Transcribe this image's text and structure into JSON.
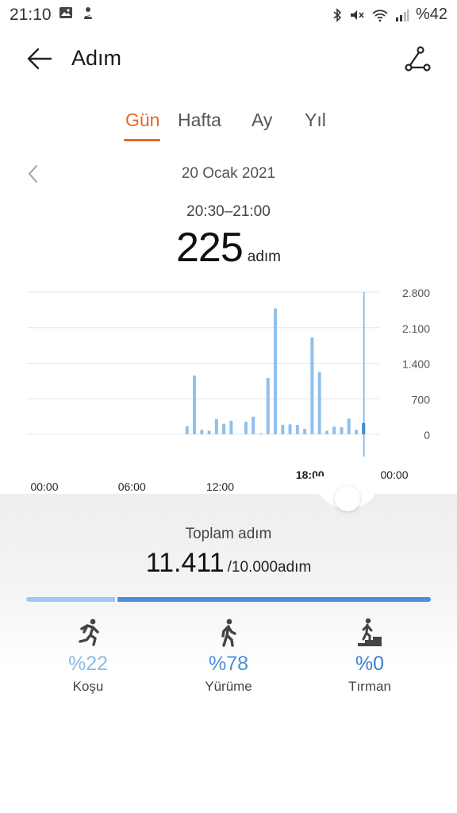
{
  "status_bar": {
    "time": "21:10",
    "battery": "%42",
    "left_icons": [
      "image-icon",
      "app-notification-icon"
    ],
    "right_icons": [
      "bluetooth-icon",
      "mute-icon",
      "wifi-icon",
      "signal-icon"
    ]
  },
  "header": {
    "title": "Adım",
    "back_icon": "arrow-left-icon",
    "share_icon": "route-icon"
  },
  "tabs": [
    {
      "label": "Gün",
      "active": true
    },
    {
      "label": "Hafta",
      "active": false
    },
    {
      "label": "Ay",
      "active": false
    },
    {
      "label": "Yıl",
      "active": false
    }
  ],
  "date": {
    "label": "20 Ocak 2021",
    "prev_icon": "chevron-left-icon"
  },
  "selection": {
    "range": "20:30–21:00",
    "value": "225",
    "unit": "adım"
  },
  "chart_data": {
    "type": "bar",
    "title": "",
    "xlabel": "",
    "ylabel": "",
    "x_unit": "hour of day",
    "ylim": [
      0,
      2800
    ],
    "y_ticks": [
      "2.800",
      "2.100",
      "1.400",
      "700",
      "0"
    ],
    "y_tick_values": [
      2800,
      2100,
      1400,
      700,
      0
    ],
    "x_tick_labels": [
      "00:00",
      "06:00",
      "12:00",
      "18:00",
      "00:00"
    ],
    "x_tick_hours": [
      0,
      6,
      12,
      18,
      24
    ],
    "highlighted_tick": "18:00",
    "grid": true,
    "bars": [
      {
        "x": 9.75,
        "value": 160
      },
      {
        "x": 10.25,
        "value": 1160
      },
      {
        "x": 10.75,
        "value": 90
      },
      {
        "x": 11.25,
        "value": 70
      },
      {
        "x": 11.75,
        "value": 300
      },
      {
        "x": 12.25,
        "value": 210
      },
      {
        "x": 12.75,
        "value": 270
      },
      {
        "x": 13.75,
        "value": 250
      },
      {
        "x": 14.25,
        "value": 350
      },
      {
        "x": 14.75,
        "value": 20
      },
      {
        "x": 15.25,
        "value": 1110
      },
      {
        "x": 15.75,
        "value": 2480
      },
      {
        "x": 16.25,
        "value": 190
      },
      {
        "x": 16.75,
        "value": 200
      },
      {
        "x": 17.25,
        "value": 185
      },
      {
        "x": 17.75,
        "value": 110
      },
      {
        "x": 18.25,
        "value": 1910
      },
      {
        "x": 18.75,
        "value": 1230
      },
      {
        "x": 19.25,
        "value": 70
      },
      {
        "x": 19.75,
        "value": 150
      },
      {
        "x": 20.25,
        "value": 140
      },
      {
        "x": 20.75,
        "value": 310
      },
      {
        "x": 21.25,
        "value": 90
      },
      {
        "x": 21.75,
        "value": 225
      }
    ],
    "selected_index": 23,
    "colors": {
      "bar": "#8fc0ee",
      "selected": "#2f7fd6",
      "grid": "#e6e6e6",
      "cursor": "#5a9ae0"
    }
  },
  "summary": {
    "label": "Toplam adım",
    "value": "11.411",
    "goal": "/10.000adım"
  },
  "breakdown": {
    "run_fraction": 0.22,
    "items": [
      {
        "pct": "%22",
        "name": "Koşu",
        "icon": "running-icon"
      },
      {
        "pct": "%78",
        "name": "Yürüme",
        "icon": "walking-icon"
      },
      {
        "pct": "%0",
        "name": "Tırman",
        "icon": "climbing-stairs-icon"
      }
    ]
  },
  "colors": {
    "accent": "#e06a2c",
    "run": "#8cbbe8",
    "walk": "#4a8fdd",
    "climb": "#3a7fd1"
  }
}
